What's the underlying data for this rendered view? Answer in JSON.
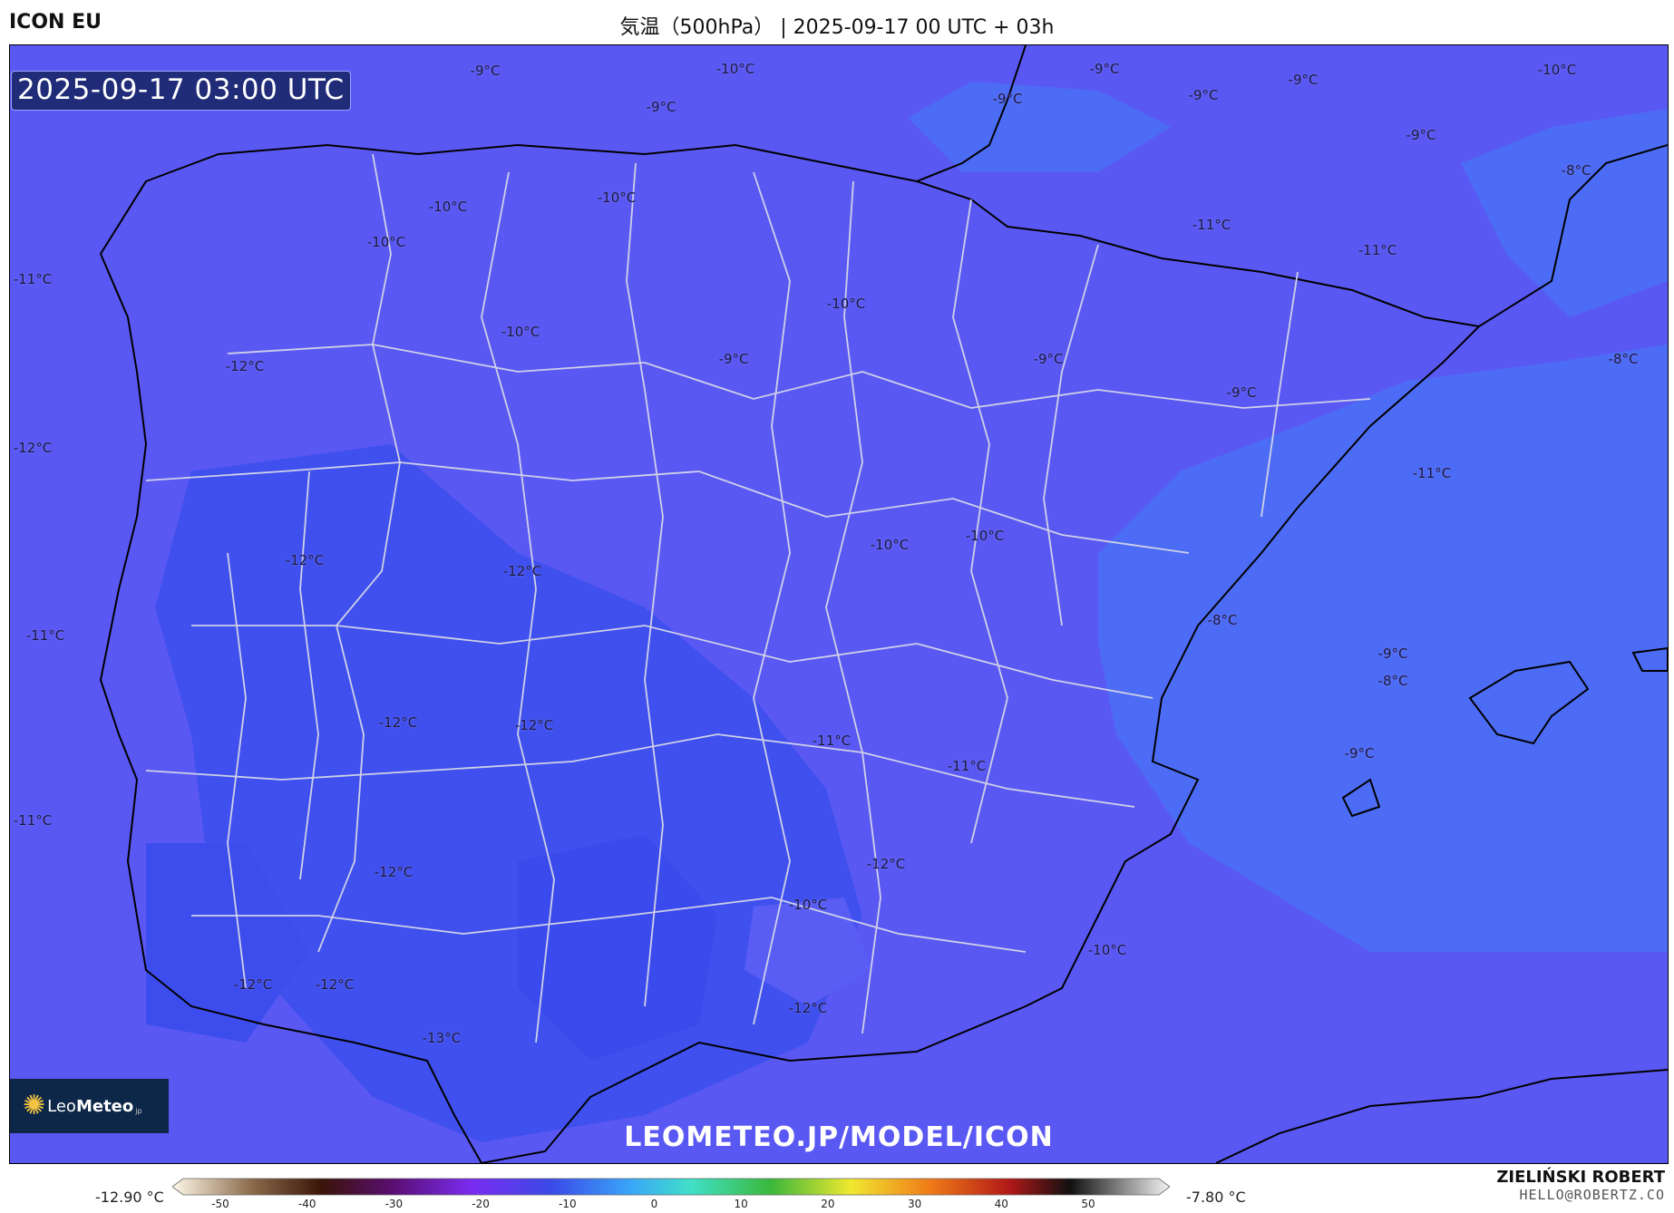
{
  "header": {
    "model_name": "ICON EU",
    "title": "気温（500hPa） | 2025-09-17 00 UTC + 03h"
  },
  "map": {
    "timestamp": "2025-09-17 03:00 UTC",
    "watermark": "LEOMETEO.JP/MODEL/ICON",
    "logo": {
      "prefix": "Leo",
      "bold": "Meteo",
      "suffix": "jp"
    },
    "colors": {
      "background": "#5a58f3",
      "sea_east": "#4d6cf5",
      "cold_inland": "#3f50ee"
    },
    "labels": [
      "-9°C",
      "-10°C",
      "-9°C",
      "-9°C",
      "-9°C",
      "-9°C",
      "-10°C",
      "-9°C",
      "-9°C",
      "-8°C",
      "-10°C",
      "-10°C",
      "-11°C",
      "-11°C",
      "-10°C",
      "-10°C",
      "-11°C",
      "-10°C",
      "-9°C",
      "-9°C",
      "-8°C",
      "-9°C",
      "-12°C",
      "-12°C",
      "-11°C",
      "-12°C",
      "-12°C",
      "-10°C",
      "-10°C",
      "-8°C",
      "-9°C",
      "-11°C",
      "-12°C",
      "-12°C",
      "-11°C",
      "-8°C",
      "-9°C",
      "-11°C",
      "-12°C",
      "-12°C",
      "-10°C",
      "-10°C",
      "-12°C",
      "-12°C",
      "-12°C",
      "-13°C",
      "-11°C"
    ]
  },
  "colorbar": {
    "min_label": "-12.90 °C",
    "max_label": "-7.80 °C",
    "ticks": [
      "-50",
      "-40",
      "-30",
      "-20",
      "-10",
      "0",
      "10",
      "20",
      "30",
      "40",
      "50"
    ]
  },
  "author": {
    "name": "ZIELIŃSKI ROBERT",
    "email": "HELLO@ROBERTZ.CO"
  }
}
